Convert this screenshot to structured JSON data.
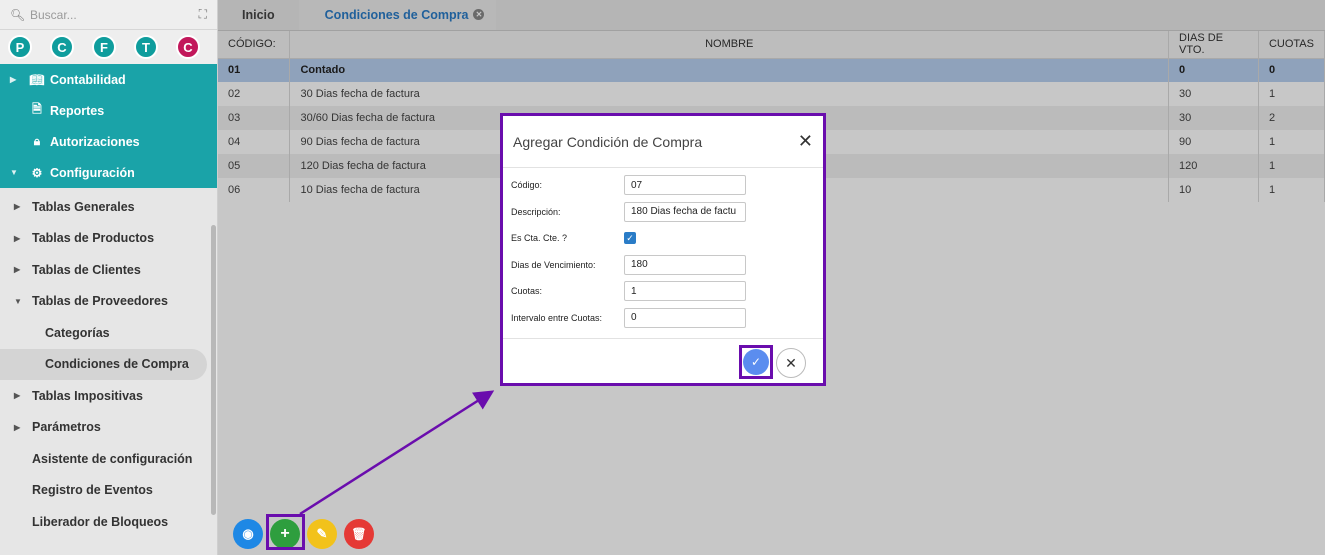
{
  "sidebar": {
    "search_placeholder": "Buscar...",
    "avatars": [
      {
        "letter": "P",
        "color": "#0f9d9d"
      },
      {
        "letter": "C",
        "color": "#0f9d9d"
      },
      {
        "letter": "F",
        "color": "#0f9d9d"
      },
      {
        "letter": "T",
        "color": "#0f9d9d"
      },
      {
        "letter": "C",
        "color": "#c2185b"
      }
    ],
    "teal_items": [
      {
        "label": "Contabilidad",
        "icon": "book-icon",
        "arrow": true
      },
      {
        "label": "Reportes",
        "icon": "report-icon",
        "arrow": false
      },
      {
        "label": "Autorizaciones",
        "icon": "lock-icon",
        "arrow": false
      },
      {
        "label": "Configuración",
        "icon": "gear-icon",
        "arrow": true,
        "expanded": true
      }
    ],
    "menu": [
      {
        "label": "Tablas Generales",
        "arrow": "right"
      },
      {
        "label": "Tablas de Productos",
        "arrow": "right"
      },
      {
        "label": "Tablas de Clientes",
        "arrow": "right"
      },
      {
        "label": "Tablas de Proveedores",
        "arrow": "down"
      },
      {
        "label": "Categorías",
        "sub": true
      },
      {
        "label": "Condiciones de Compra",
        "sub": true,
        "active": true
      },
      {
        "label": "Tablas Impositivas",
        "arrow": "right"
      },
      {
        "label": "Parámetros",
        "arrow": "right"
      },
      {
        "label": "Asistente de configuración",
        "plain": true
      },
      {
        "label": "Registro de Eventos",
        "plain": true
      },
      {
        "label": "Liberador de Bloqueos",
        "plain": true
      }
    ]
  },
  "tabs": {
    "home": "Inicio",
    "active": "Condiciones de Compra"
  },
  "table": {
    "headers": {
      "codigo": "CÓDIGO:",
      "nombre": "NOMBRE",
      "dias": "DIAS DE VTO.",
      "cuotas": "CUOTAS"
    },
    "rows": [
      {
        "codigo": "01",
        "nombre": "Contado",
        "dias": "0",
        "cuotas": "0"
      },
      {
        "codigo": "02",
        "nombre": "30 Dias fecha de factura",
        "dias": "30",
        "cuotas": "1"
      },
      {
        "codigo": "03",
        "nombre": "30/60 Dias fecha de factura",
        "dias": "30",
        "cuotas": "2"
      },
      {
        "codigo": "04",
        "nombre": "90 Dias fecha de factura",
        "dias": "90",
        "cuotas": "1"
      },
      {
        "codigo": "05",
        "nombre": "120 Dias fecha de factura",
        "dias": "120",
        "cuotas": "1"
      },
      {
        "codigo": "06",
        "nombre": "10 Dias fecha de factura",
        "dias": "10",
        "cuotas": "1"
      }
    ]
  },
  "toolbar": {
    "view_color": "#1e88e5",
    "add_color": "#2e9e3e",
    "edit_color": "#f2c21b",
    "delete_color": "#e53935"
  },
  "dialog": {
    "title": "Agregar Condición de Compra",
    "fields": {
      "codigo_label": "Código:",
      "codigo_value": "07",
      "descripcion_label": "Descripción:",
      "descripcion_value": "180 Dias fecha de factu",
      "cta_label": "Es Cta. Cte. ?",
      "cta_checked": true,
      "dias_label": "Dias de Vencimiento:",
      "dias_value": "180",
      "cuotas_label": "Cuotas:",
      "cuotas_value": "1",
      "intervalo_label": "Intervalo entre Cuotas:",
      "intervalo_value": "0"
    }
  },
  "annotation_color": "#6a0dad"
}
